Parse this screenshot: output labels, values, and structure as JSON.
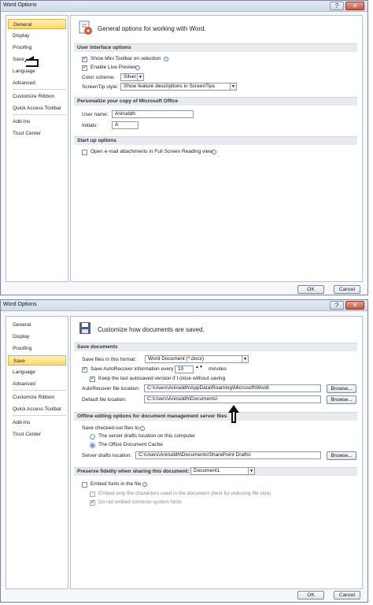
{
  "window1": {
    "title": "Word Options",
    "controls": {
      "help": "?",
      "close": "✕"
    },
    "nav": [
      "General",
      "Display",
      "Proofing",
      "Save",
      "Language",
      "Advanced",
      "Customize Ribbon",
      "Quick Access Toolbar",
      "Add-Ins",
      "Trust Center"
    ],
    "header_text": "General options for working with Word.",
    "sections": {
      "ui": "User Interface options",
      "personalize": "Personalize your copy of Microsoft Office",
      "startup": "Start up options"
    },
    "options": {
      "mini_toolbar": "Show Mini Toolbar on selection",
      "live_preview": "Enable Live Preview",
      "color_scheme_label": "Color scheme:",
      "color_scheme_value": "Silver",
      "screentip_label": "ScreenTip style:",
      "screentip_value": "Show feature descriptions in ScreenTips",
      "username_label": "User name:",
      "username_value": "Aniruddh",
      "initials_label": "Initials:",
      "initials_value": "A",
      "startup_checkbox": "Open e-mail attachments in Full Screen Reading view"
    },
    "buttons": {
      "ok": "OK",
      "cancel": "Cancel"
    }
  },
  "window2": {
    "title": "Word Options",
    "controls": {
      "help": "?",
      "close": "✕"
    },
    "nav": [
      "General",
      "Display",
      "Proofing",
      "Save",
      "Language",
      "Advanced",
      "Customize Ribbon",
      "Quick Access Toolbar",
      "Add-Ins",
      "Trust Center"
    ],
    "header_text": "Customize how documents are saved.",
    "sections": {
      "save_documents": "Save documents",
      "offline": "Offline editing options for document management server files",
      "fidelity": "Preserve fidelity when sharing this document:"
    },
    "save": {
      "format_label": "Save files in this format:",
      "format_value": "Word Document (*.docx)",
      "autorecover_label": "Save AutoRecover information every",
      "autorecover_value": "10",
      "minutes": "minutes",
      "keep_last": "Keep the last autosaved version if I close without saving",
      "autorecover_location_label": "AutoRecover file location:",
      "autorecover_location_value": "C:\\Users\\Aniruddh\\AppData\\Roaming\\Microsoft\\Word\\",
      "default_location_label": "Default file location:",
      "default_location_value": "C:\\Users\\Aniruddh\\Documents\\",
      "browse": "Browse..."
    },
    "offline": {
      "checked_out_label": "Save checked-out files to:",
      "server_drafts": "The server drafts location on this computer",
      "office_cache": "The Office Document Cache",
      "drafts_location_label": "Server drafts location:",
      "drafts_location_value": "C:\\Users\\Aniruddh\\Documents\\SharePoint Drafts\\",
      "browse": "Browse..."
    },
    "fidelity": {
      "document_value": "Document1",
      "embed_fonts": "Embed fonts in the file",
      "embed_only": "Embed only the characters used in the document (best for reducing file size)",
      "no_common": "Do not embed common system fonts"
    },
    "buttons": {
      "ok": "OK",
      "cancel": "Cancel"
    }
  },
  "annotations": {
    "arrow_left": "",
    "arrow_up": ""
  },
  "colors": {
    "accent": "#ffd86c",
    "section_bg": "#e7eaee",
    "window_bg": "#f5f7fa"
  }
}
